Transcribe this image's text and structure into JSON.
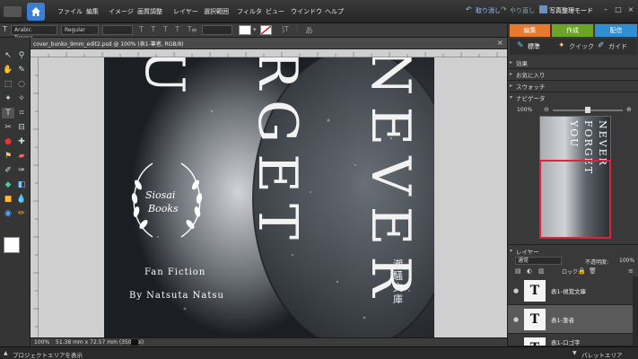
{
  "menubar": {
    "items": [
      "ファイル",
      "編集",
      "イメージ",
      "画質調整",
      "レイヤー",
      "選択範囲",
      "フィルタ",
      "ビュー",
      "ウインドウ",
      "ヘルプ"
    ],
    "undo_label": "取り消し",
    "redo_label": "やり直し",
    "organizer_label": "写真整理モード"
  },
  "options": {
    "font_family": "Arabic Typese...",
    "font_style": "Regular",
    "aa_glyph": "あ"
  },
  "document": {
    "tab_title": "cover_bunko_9mm_edit2.psd @ 100% (表1-筆者, RGB/8)",
    "zoom": "100%",
    "dimensions": "51.38 mm x 72.57 mm (350 ppi)"
  },
  "cover": {
    "title_left": "RGET",
    "title_top": "U",
    "title_right": "NEVER",
    "seal_line1": "Siosai",
    "seal_line2": "Books",
    "fan_fiction": "Fan Fiction",
    "author": "By Natsuta Natsu",
    "publisher_vertical": "潮騒文庫"
  },
  "panel": {
    "tabs": [
      "編集",
      "作成",
      "配信"
    ],
    "subtabs": [
      "標準",
      "クイック",
      "ガイド"
    ],
    "sections": [
      "効果",
      "お気に入り",
      "スウォッチ",
      "ナビゲータ"
    ],
    "nav_zoom": "100%",
    "nav_thumb_lines": [
      "NEVER",
      "FORGET",
      "YOU"
    ],
    "layers_header": "レイヤー",
    "blend_mode": "通常",
    "opacity_label": "不透明度:",
    "opacity_value": "100%",
    "lock_label": "ロック:",
    "layers": [
      {
        "name": "表1-視覚文庫"
      },
      {
        "name": "表1-筆者"
      },
      {
        "name": "表1-ロゴ字"
      }
    ]
  },
  "bottombar": {
    "project_bin": "プロジェクトエリアを表示",
    "palette_bin": "パレットエリア"
  },
  "colors": {
    "accent_tab_edit": "#e8782a",
    "accent_tab_create": "#6aa526",
    "accent_tab_share": "#2e8fd6",
    "nav_box": "#e0233a"
  }
}
